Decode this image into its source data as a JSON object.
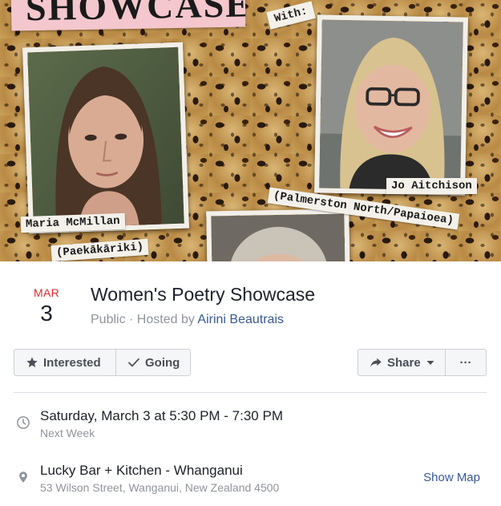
{
  "cover": {
    "banner_text": "SHOWCASE",
    "with_label": "With:",
    "performers": [
      {
        "name": "Maria McMillan",
        "place": "(Paekākāriki)"
      },
      {
        "name": "Jo Aitchison",
        "place": "(Palmerston North/Papaioea)"
      }
    ]
  },
  "event": {
    "month": "MAR",
    "day": "3",
    "title": "Women's Poetry Showcase",
    "visibility": "Public",
    "hosted_by_prefix": " · Hosted by ",
    "host": "Airini Beautrais"
  },
  "actions": {
    "interested": "Interested",
    "going": "Going",
    "share": "Share",
    "more": "···"
  },
  "details": {
    "time_primary": "Saturday, March 3 at 5:30 PM - 7:30 PM",
    "time_secondary": "Next Week",
    "location_primary": "Lucky Bar + Kitchen - Whanganui",
    "location_secondary": "53 Wilson Street, Wanganui, New Zealand 4500",
    "show_map": "Show Map"
  },
  "colors": {
    "month": "#e02a2a",
    "link": "#385898",
    "muted": "#90949c",
    "button_bg": "#f5f6f7"
  },
  "icons": [
    "star-icon",
    "checkmark-icon",
    "share-arrow-icon",
    "caret-down-icon",
    "clock-icon",
    "map-pin-icon"
  ]
}
